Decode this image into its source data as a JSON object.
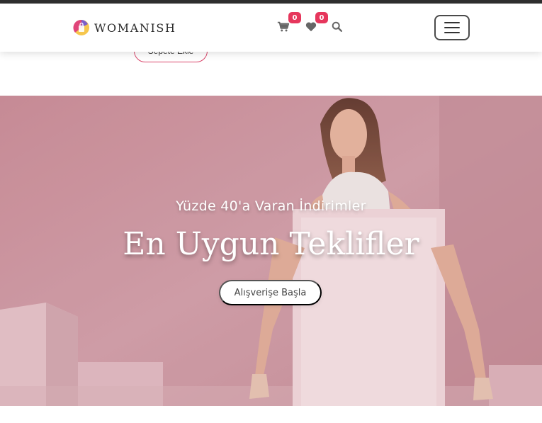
{
  "brand": {
    "name": "WOMANISH",
    "logo_icon": "shopping-bag-logo-icon"
  },
  "header": {
    "cart_icon": "cart-icon",
    "cart_count": "0",
    "favorites_icon": "heart-icon",
    "favorites_count": "0",
    "search_icon": "search-icon",
    "menu_icon": "hamburger-menu-icon",
    "badge_color": "#e6365c"
  },
  "product": {
    "add_to_cart_label": "Sepete Ekle"
  },
  "hero": {
    "subtitle": "Yüzde 40'a Varan İndirimler",
    "title": "En Uygun Teklifler",
    "button_label": "Alışverişe Başla",
    "background_color": "#d4a3ac"
  }
}
